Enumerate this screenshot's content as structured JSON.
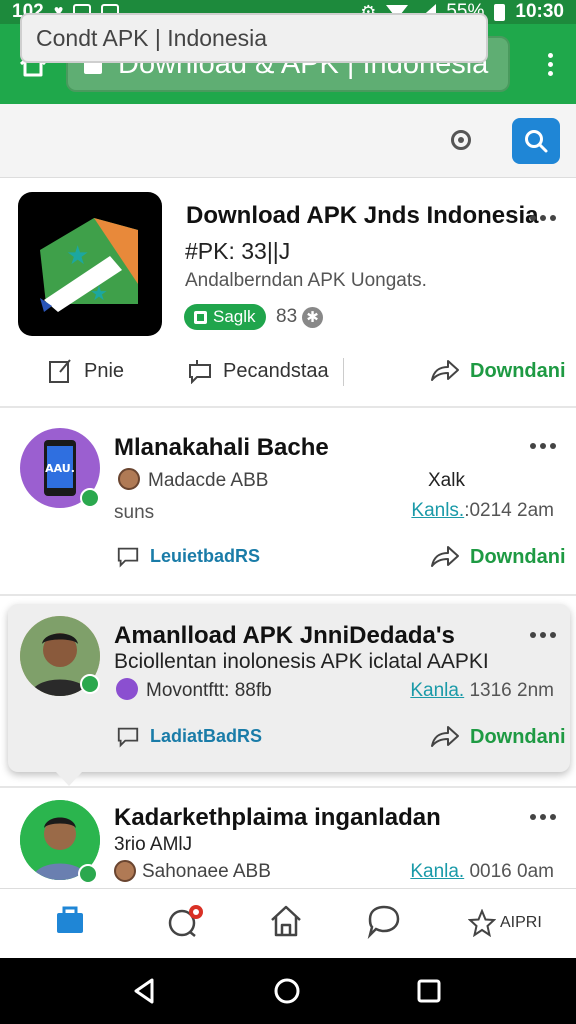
{
  "status_bar": {
    "left_text": "102",
    "battery": "55%",
    "time": "10:30"
  },
  "browser": {
    "url_title": "Download & APK | Indonesia"
  },
  "search": {
    "value": "Condt APK | Indonesia"
  },
  "app_card": {
    "title": "Download APK Jnds Indonesia",
    "subtitle": "#PK: 33||J",
    "description": "Andalberndan APK Uongats.",
    "pill_label": "Saglk",
    "count": "83",
    "actions": {
      "pin": "Pnie",
      "comment": "Pecandstaa",
      "download": "Downdani"
    }
  },
  "posts": [
    {
      "title": "Mlanakahali Bache",
      "author": "Madacde ABB",
      "extra_left": "suns",
      "extra_right": "Xalk",
      "time_label": "Kanls.",
      "time": ":0214 2am",
      "action_left": "LeuietbadRS",
      "action_right": "Downdani",
      "avatar_text": "AAU."
    },
    {
      "title": "Amanlload APK JnniDedada's",
      "body": "Bciollentan inolonesis APK iclatal AAPKI",
      "author": "Movontftt: 88fb",
      "time_label": "Kanla.",
      "time": "1316 2nm",
      "action_left": "LadiatBadRS",
      "action_right": "Downdani"
    },
    {
      "title": "Kadarkethplaima inganladan",
      "subtitle": "3rio AMlJ",
      "author": "Sahonaee ABB",
      "time_label": "Kanla.",
      "time": "0016 0am"
    }
  ],
  "bottom_nav": {
    "last_label": "AIPRI"
  },
  "colors": {
    "header_green": "#1fa84b",
    "status_green": "#1d8a3c",
    "download_green": "#1e9a43",
    "search_blue": "#1f86d6",
    "link_teal": "#1a9aa8"
  },
  "icons": [
    "home-icon",
    "lock-icon",
    "more-vert-icon",
    "mic-icon",
    "search-icon",
    "edit-icon",
    "comment-icon",
    "share-icon",
    "home-tab-icon",
    "chat-icon",
    "star-icon",
    "back-icon",
    "recents-icon"
  ]
}
